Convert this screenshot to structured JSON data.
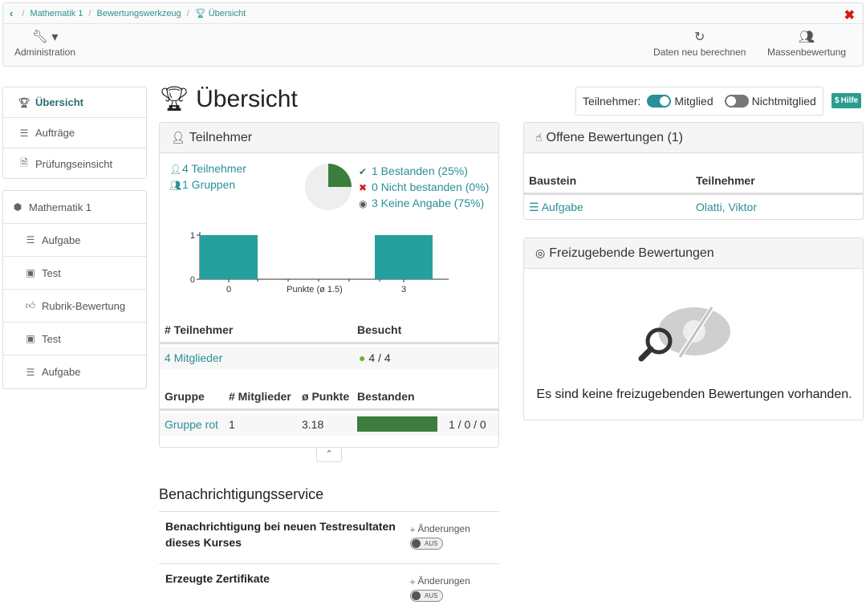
{
  "breadcrumb": {
    "items": [
      "Mathematik 1",
      "Bewertungswerkzeug",
      "Übersicht"
    ]
  },
  "toolbar": {
    "administration": "Administration",
    "recalc": "Daten neu berechnen",
    "mass": "Massenbewertung"
  },
  "sidebar": {
    "nav": [
      "Übersicht",
      "Aufträge",
      "Prüfungseinsicht"
    ],
    "course": "Mathematik 1",
    "elements": [
      {
        "label": "Aufgabe",
        "icon": "list-icon"
      },
      {
        "label": "Test",
        "icon": "test-icon"
      },
      {
        "label": "Rubrik-Bewertung",
        "icon": "thumbs-up-icon"
      },
      {
        "label": "Test",
        "icon": "test-icon"
      },
      {
        "label": "Aufgabe",
        "icon": "list-icon"
      }
    ]
  },
  "page": {
    "title": "Übersicht"
  },
  "filter": {
    "label": "Teilnehmer:",
    "member": "Mitglied",
    "nonmember": "Nichtmitglied",
    "member_on": true,
    "nonmember_on": false
  },
  "help": "Hilfe",
  "participants": {
    "title": "Teilnehmer",
    "count": "4 Teilnehmer",
    "groups": "1 Gruppen",
    "passed": "1 Bestanden (25%)",
    "failed": "0 Nicht bestanden (0%)",
    "none": "3 Keine Angabe (75%)",
    "pie_passed_fraction": 0.25,
    "table1": {
      "headers": [
        "# Teilnehmer",
        "Besucht"
      ],
      "rows": [
        [
          "4 Mitglieder",
          "4 / 4"
        ]
      ]
    },
    "table2": {
      "headers": [
        "Gruppe",
        "# Mitglieder",
        "ø Punkte",
        "Bestanden"
      ],
      "rows": [
        [
          "Gruppe rot",
          "1",
          "3.18",
          "1 / 0 / 0"
        ]
      ],
      "bar_fraction": 1.0
    }
  },
  "chart_data": {
    "type": "bar",
    "categories": [
      "0",
      "3"
    ],
    "values": [
      1,
      1
    ],
    "xlabel": "Punkte (ø 1.5)",
    "ylim": [
      0,
      1
    ],
    "yticks": [
      "1",
      "0"
    ],
    "color": "#26a09e"
  },
  "open_reviews": {
    "title": "Offene Bewertungen (1)",
    "headers": [
      "Baustein",
      "Teilnehmer"
    ],
    "rows": [
      [
        "Aufgabe",
        "Olatti, Viktor"
      ]
    ]
  },
  "release": {
    "title": "Freizugebende Bewertungen",
    "empty": "Es sind keine freizugebenden Bewertungen vorhanden."
  },
  "notifications": {
    "title": "Benachrichtigungsservice",
    "items": [
      {
        "text": "Benachrichtigung bei neuen Testresultaten dieses Kurses",
        "side": "Änderungen",
        "state": "AUS"
      },
      {
        "text": "Erzeugte Zertifikate",
        "side": "Änderungen",
        "state": "AUS"
      }
    ]
  }
}
